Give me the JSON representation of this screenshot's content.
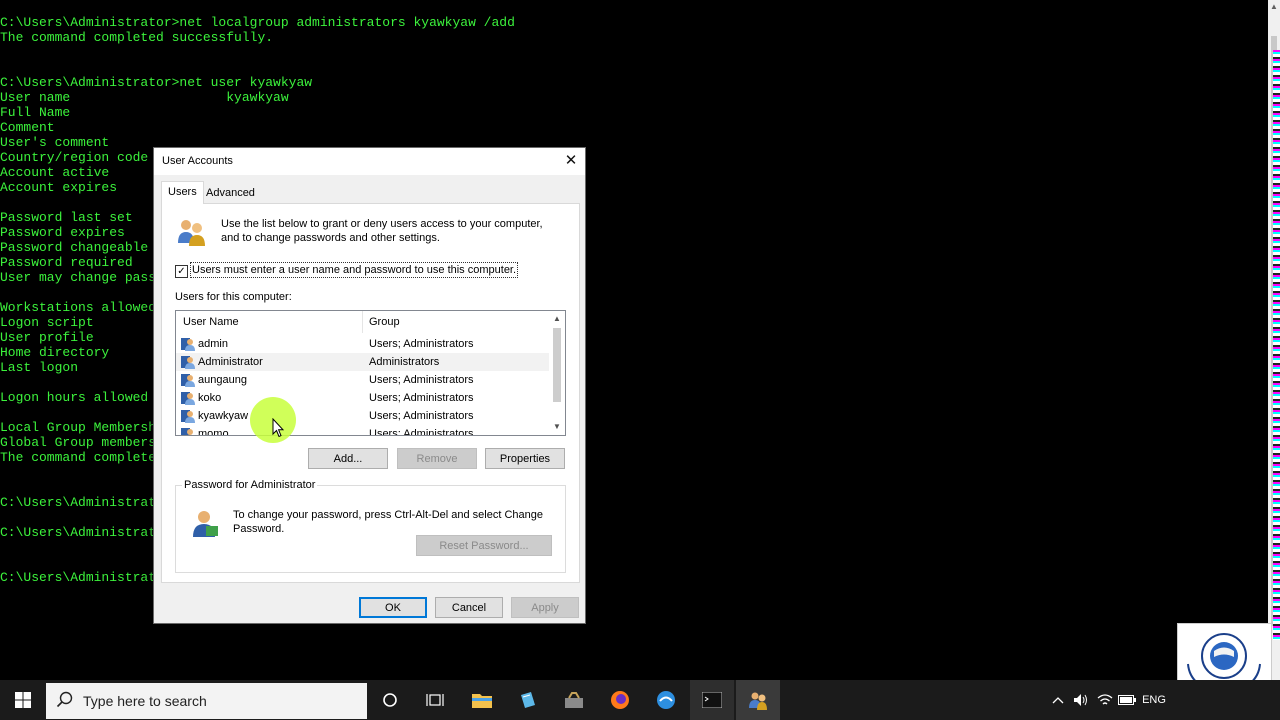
{
  "console": {
    "lines": [
      "C:\\Users\\Administrator>net localgroup administrators kyawkyaw /add",
      "The command completed successfully.",
      "",
      "",
      "C:\\Users\\Administrator>net user kyawkyaw",
      "User name                    kyawkyaw",
      "Full Name",
      "Comment",
      "User's comment",
      "Country/region code",
      "Account active",
      "Account expires",
      "",
      "Password last set",
      "Password expires",
      "Password changeable",
      "Password required",
      "User may change passw",
      "",
      "Workstations allowed",
      "Logon script",
      "User profile",
      "Home directory",
      "Last logon",
      "",
      "Logon hours allowed",
      "",
      "Local Group Membershi",
      "Global Group membersh",
      "The command completed",
      "",
      "",
      "C:\\Users\\Administrato",
      "",
      "C:\\Users\\Administrato",
      "",
      "",
      "C:\\Users\\Administrato"
    ]
  },
  "dialog": {
    "title": "User Accounts",
    "close_glyph": "✕",
    "tabs": [
      {
        "label": "Users"
      },
      {
        "label": "Advanced"
      }
    ],
    "intro": "Use the list below to grant or deny users access to your computer, and to change passwords and other settings.",
    "checkbox": {
      "label": "Users must enter a user name and password to use this computer.",
      "checked": true,
      "mark": "✓"
    },
    "users_label": "Users for this computer:",
    "columns": {
      "name": "User Name",
      "group": "Group"
    },
    "users": [
      {
        "name": "admin",
        "group": "Users; Administrators"
      },
      {
        "name": "Administrator",
        "group": "Administrators"
      },
      {
        "name": "aungaung",
        "group": "Users; Administrators"
      },
      {
        "name": "koko",
        "group": "Users; Administrators"
      },
      {
        "name": "kyawkyaw",
        "group": "Users; Administrators"
      },
      {
        "name": "momo",
        "group": "Users; Administrators"
      }
    ],
    "selected_user": "Administrator",
    "buttons": {
      "add": "Add...",
      "remove": "Remove",
      "properties": "Properties"
    },
    "password_group": {
      "legend": "Password for Administrator",
      "text": "To change your password, press Ctrl-Alt-Del and select Change Password.",
      "reset": "Reset Password..."
    },
    "footer": {
      "ok": "OK",
      "cancel": "Cancel",
      "apply": "Apply"
    }
  },
  "taskbar": {
    "search_placeholder": "Type here to search",
    "language": "ENG",
    "apps": [
      "task-view-icon",
      "file-explorer-icon",
      "notepad-icon",
      "toolbox-icon",
      "firefox-icon",
      "edge-icon",
      "cmd-icon",
      "user-accounts-icon"
    ]
  },
  "colors": {
    "console_text": "#3cf23c",
    "console_bg": "#000000",
    "taskbar": "#1b1b1b",
    "accent": "#0078d7"
  }
}
